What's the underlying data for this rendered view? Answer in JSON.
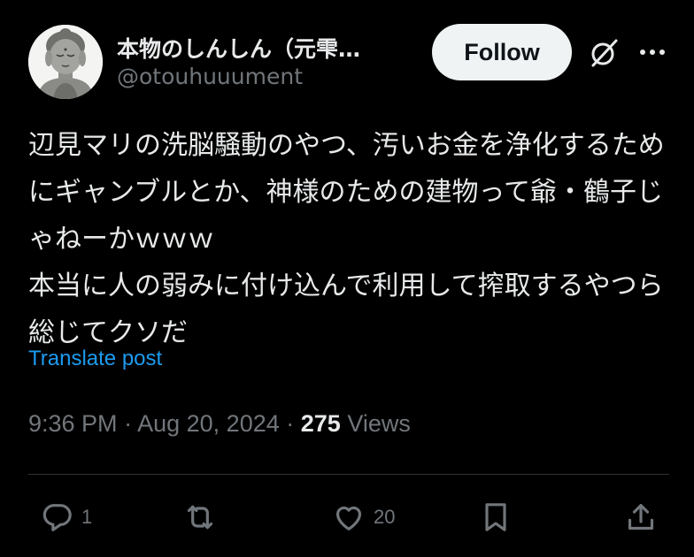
{
  "author": {
    "name": "本物のしんしん（元雫…",
    "handle": "@otouhuuument",
    "avatar_icon": "buddha-statue-avatar-icon"
  },
  "follow_label": "Follow",
  "icons": {
    "grok": "grok-icon",
    "more": "more-icon"
  },
  "post": {
    "text": "辺見マリの洗脳騒動のやつ、汚いお金を浄化するためにギャンブルとか、神様のための建物って爺・鶴子じゃねーかｗｗｗ\n本当に人の弱みに付け込んで利用して搾取するやつら総じてクソだ"
  },
  "translate_label": "Translate post",
  "meta": {
    "time": "9:36 PM",
    "date": "Aug 20, 2024",
    "views_count": "275",
    "views_label": "Views"
  },
  "actions": {
    "reply_count": "1",
    "repost_count": "",
    "like_count": "20"
  },
  "colors": {
    "background": "#000000",
    "text": "#e7e9ea",
    "muted": "#71767b",
    "link": "#1d9bf0",
    "follow_bg": "#eff3f4"
  }
}
